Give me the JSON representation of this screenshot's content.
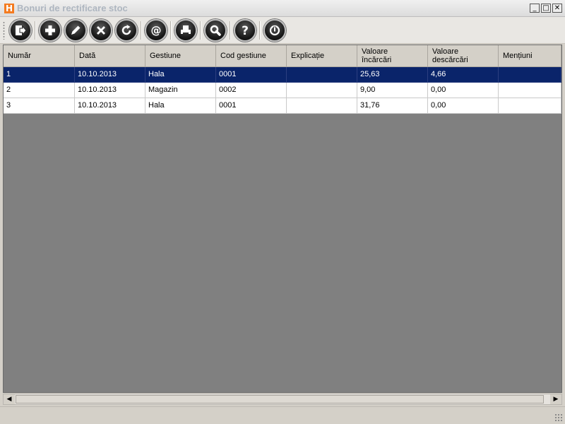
{
  "window": {
    "title": "Bonuri de rectificare stoc",
    "app_icon_letter": "H",
    "controls": {
      "minimize": "_",
      "maximize": "□",
      "close": "✕"
    }
  },
  "toolbar": {
    "buttons": [
      {
        "name": "exit-icon"
      },
      {
        "name": "add-icon"
      },
      {
        "name": "edit-icon"
      },
      {
        "name": "delete-icon"
      },
      {
        "name": "refresh-icon"
      },
      {
        "name": "email-icon"
      },
      {
        "name": "print-icon"
      },
      {
        "name": "search-icon"
      },
      {
        "name": "help-icon"
      },
      {
        "name": "power-icon"
      }
    ]
  },
  "table": {
    "columns": [
      "Număr",
      "Dată",
      "Gestiune",
      "Cod gestiune",
      "Explicație",
      "Valoare\nîncărcări",
      "Valoare\ndescărcări",
      "Mențiuni"
    ],
    "rows": [
      [
        "1",
        "10.10.2013",
        "Hala",
        "0001",
        "",
        "25,63",
        "4,66",
        ""
      ],
      [
        "2",
        "10.10.2013",
        "Magazin",
        "0002",
        "",
        "9,00",
        "0,00",
        ""
      ],
      [
        "3",
        "10.10.2013",
        "Hala",
        "0001",
        "",
        "31,76",
        "0,00",
        ""
      ]
    ],
    "selected_row": 0
  },
  "scrollbar": {
    "left_arrow": "◀",
    "right_arrow": "▶"
  }
}
